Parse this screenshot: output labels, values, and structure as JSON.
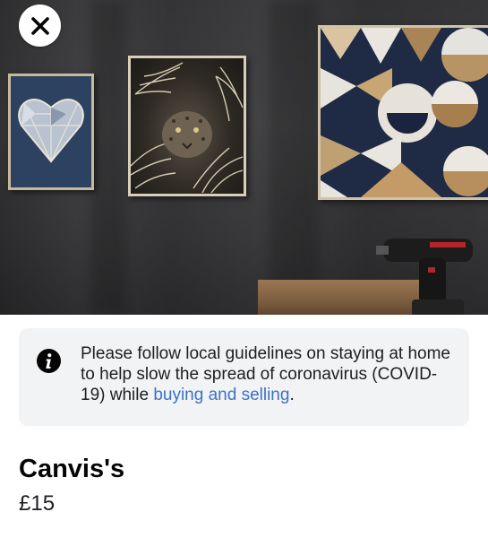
{
  "photo": {
    "alt_subject": "canvas-wall-art-photo"
  },
  "close_button": {
    "icon": "close-icon"
  },
  "notice": {
    "icon": "info-icon",
    "text_before": "Please follow local guidelines on staying at home to help slow the spread of coronavirus (COVID-19) while ",
    "link_text": "buying and selling",
    "text_after": ".",
    "link_color": "#3b71c8",
    "background": "#f2f3f5"
  },
  "listing": {
    "title": "Canvis's",
    "price": "£15"
  }
}
